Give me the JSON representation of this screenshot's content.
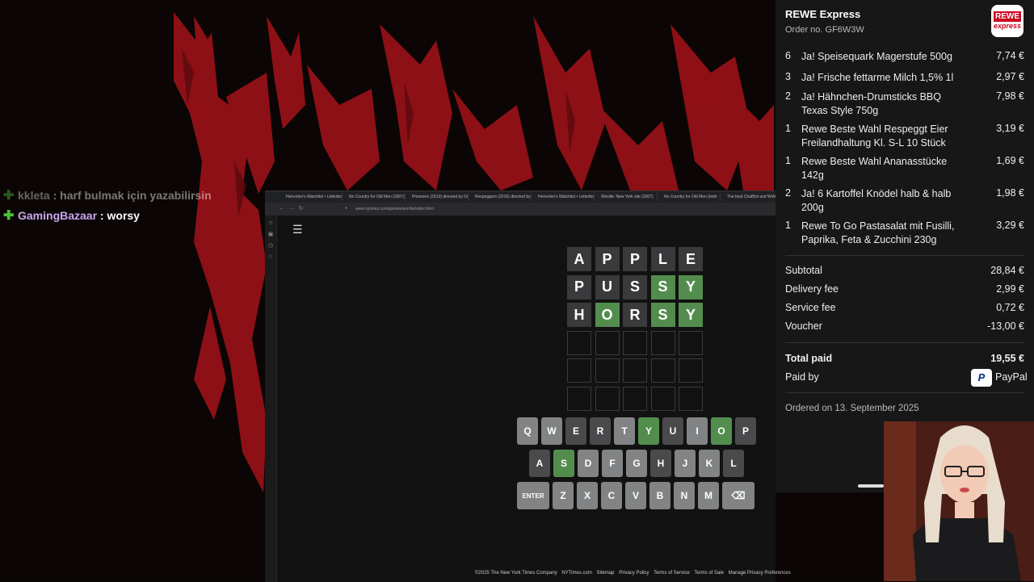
{
  "chat": [
    {
      "user": "kkleta",
      "message": "harf bulmak için yazabilirsin"
    },
    {
      "user": "GamingBazaar",
      "message": "worsy"
    }
  ],
  "browser": {
    "tabs": [
      "Henvolen's Watchlist • Letterbo",
      "No Country for Old Men (2007)",
      "Prisoners (2013) directed by De",
      "Respeggers (2016) directed by",
      "Henvolen's Watchlist • Letterbo",
      "Wordle: New York site (2007)",
      "No Country for Old Men (both",
      "The best ChatBot and Writing"
    ],
    "url": "www.nytimes.com/games/wordle/index.html"
  },
  "wordle": {
    "rows": [
      [
        {
          "letter": "A",
          "state": "absent"
        },
        {
          "letter": "P",
          "state": "absent"
        },
        {
          "letter": "P",
          "state": "absent"
        },
        {
          "letter": "L",
          "state": "absent"
        },
        {
          "letter": "E",
          "state": "absent"
        }
      ],
      [
        {
          "letter": "P",
          "state": "absent"
        },
        {
          "letter": "U",
          "state": "absent"
        },
        {
          "letter": "S",
          "state": "absent"
        },
        {
          "letter": "S",
          "state": "correct"
        },
        {
          "letter": "Y",
          "state": "correct"
        }
      ],
      [
        {
          "letter": "H",
          "state": "absent"
        },
        {
          "letter": "O",
          "state": "correct"
        },
        {
          "letter": "R",
          "state": "absent"
        },
        {
          "letter": "S",
          "state": "correct"
        },
        {
          "letter": "Y",
          "state": "correct"
        }
      ],
      [
        {
          "letter": "",
          "state": "empty"
        },
        {
          "letter": "",
          "state": "empty"
        },
        {
          "letter": "",
          "state": "empty"
        },
        {
          "letter": "",
          "state": "empty"
        },
        {
          "letter": "",
          "state": "empty"
        }
      ],
      [
        {
          "letter": "",
          "state": "empty"
        },
        {
          "letter": "",
          "state": "empty"
        },
        {
          "letter": "",
          "state": "empty"
        },
        {
          "letter": "",
          "state": "empty"
        },
        {
          "letter": "",
          "state": "empty"
        }
      ],
      [
        {
          "letter": "",
          "state": "empty"
        },
        {
          "letter": "",
          "state": "empty"
        },
        {
          "letter": "",
          "state": "empty"
        },
        {
          "letter": "",
          "state": "empty"
        },
        {
          "letter": "",
          "state": "empty"
        }
      ]
    ],
    "keyboard": [
      [
        {
          "k": "Q",
          "s": "unused"
        },
        {
          "k": "W",
          "s": "unused"
        },
        {
          "k": "E",
          "s": "absent"
        },
        {
          "k": "R",
          "s": "absent"
        },
        {
          "k": "T",
          "s": "unused"
        },
        {
          "k": "Y",
          "s": "correct"
        },
        {
          "k": "U",
          "s": "absent"
        },
        {
          "k": "I",
          "s": "unused"
        },
        {
          "k": "O",
          "s": "correct"
        },
        {
          "k": "P",
          "s": "absent"
        }
      ],
      [
        {
          "k": "A",
          "s": "absent"
        },
        {
          "k": "S",
          "s": "correct"
        },
        {
          "k": "D",
          "s": "unused"
        },
        {
          "k": "F",
          "s": "unused"
        },
        {
          "k": "G",
          "s": "unused"
        },
        {
          "k": "H",
          "s": "absent"
        },
        {
          "k": "J",
          "s": "unused"
        },
        {
          "k": "K",
          "s": "unused"
        },
        {
          "k": "L",
          "s": "absent"
        }
      ],
      [
        {
          "k": "ENTER",
          "s": "unused"
        },
        {
          "k": "Z",
          "s": "unused"
        },
        {
          "k": "X",
          "s": "unused"
        },
        {
          "k": "C",
          "s": "unused"
        },
        {
          "k": "V",
          "s": "unused"
        },
        {
          "k": "B",
          "s": "unused"
        },
        {
          "k": "N",
          "s": "unused"
        },
        {
          "k": "M",
          "s": "unused"
        },
        {
          "k": "⌫",
          "s": "unused"
        }
      ]
    ],
    "footer": [
      "©2025 The New York Times Company",
      "NYTimes.com",
      "Sitemap",
      "Privacy Policy",
      "Terms of Service",
      "Terms of Sale",
      "Manage Privacy Preferences"
    ]
  },
  "receipt": {
    "store": "REWE Express",
    "order_no": "Order no. GF6W3W",
    "logo_top": "REWE",
    "logo_bottom": "express",
    "items": [
      {
        "qty": "6",
        "name": "Ja! Speisequark Magerstufe 500g",
        "price": "7,74 €"
      },
      {
        "qty": "3",
        "name": "Ja! Frische fettarme Milch 1,5% 1l",
        "price": "2,97 €"
      },
      {
        "qty": "2",
        "name": "Ja! Hähnchen-Drumsticks BBQ Texas Style 750g",
        "price": "7,98 €"
      },
      {
        "qty": "1",
        "name": "Rewe Beste Wahl Respeggt Eier Freilandhaltung Kl. S-L 10 Stück",
        "price": "3,19 €"
      },
      {
        "qty": "1",
        "name": "Rewe Beste Wahl Ananasstücke 142g",
        "price": "1,69 €"
      },
      {
        "qty": "2",
        "name": "Ja! 6 Kartoffel Knödel halb & halb 200g",
        "price": "1,98 €"
      },
      {
        "qty": "1",
        "name": "Rewe To Go Pastasalat mit Fusilli, Paprika, Feta & Zucchini 230g",
        "price": "3,29 €"
      }
    ],
    "subtotal_label": "Subtotal",
    "subtotal": "28,84 €",
    "delivery_label": "Delivery fee",
    "delivery": "2,99 €",
    "service_label": "Service fee",
    "service": "0,72 €",
    "voucher_label": "Voucher",
    "voucher": "-13,00 €",
    "total_label": "Total paid",
    "total": "19,55 €",
    "paid_by_label": "Paid by",
    "paid_by": "PayPal",
    "ordered_on": "Ordered on 13. September 2025"
  },
  "colors": {
    "correct": "#538d4e",
    "absent": "#3a3a3c",
    "key_unused": "#818384",
    "key_absent": "#4a4a4c",
    "accent_red": "#b01818"
  }
}
